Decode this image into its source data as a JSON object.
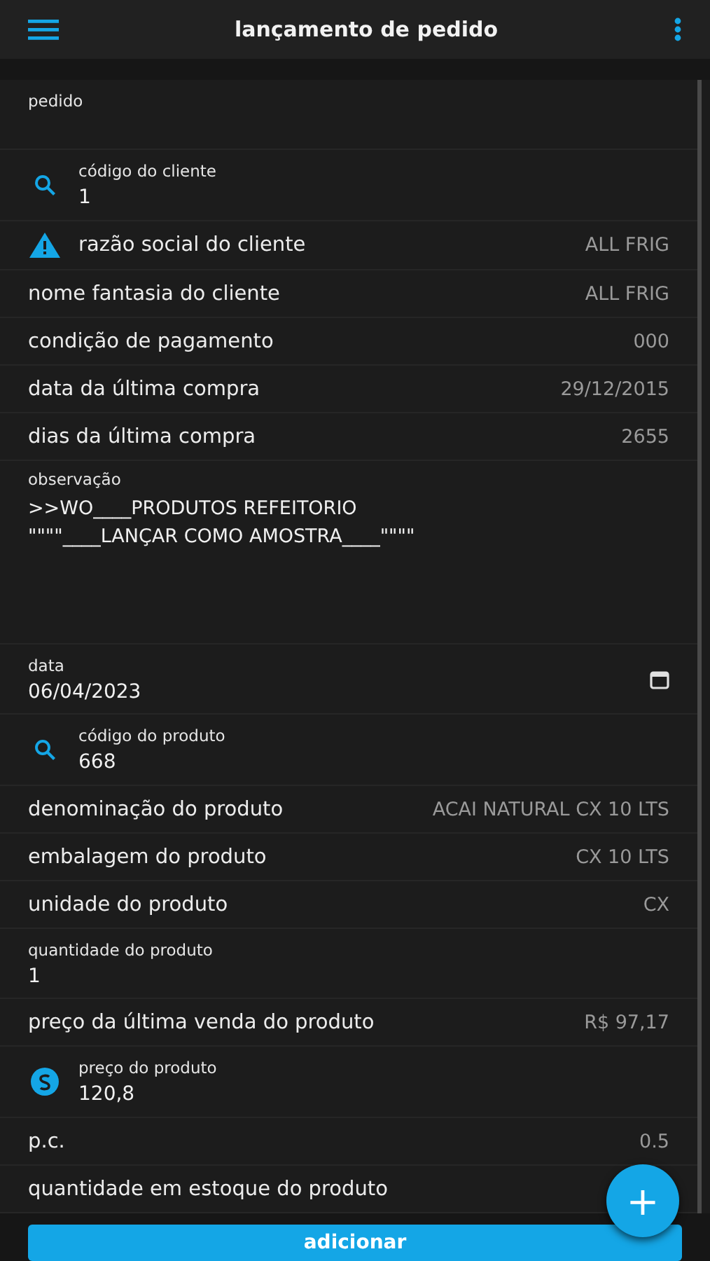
{
  "app_bar": {
    "title": "lançamento de pedido"
  },
  "rows": [
    {
      "kind": "section",
      "label": "pedido"
    },
    {
      "kind": "lookup",
      "label": "código do cliente",
      "value": "1"
    },
    {
      "kind": "alert",
      "label": "razão social do cliente",
      "value": "ALL FRIG"
    },
    {
      "kind": "pair",
      "label": "nome fantasia do cliente",
      "value": "ALL FRIG"
    },
    {
      "kind": "pair",
      "label": "condição de pagamento",
      "value": "000"
    },
    {
      "kind": "pair",
      "label": "data da última compra",
      "value": "29/12/2015"
    },
    {
      "kind": "pair",
      "label": "dias da última compra",
      "value": "2655"
    },
    {
      "kind": "note",
      "label": "observação",
      "lines": [
        ">>WO____PRODUTOS REFEITORIO",
        "\"\"\"\"____LANÇAR COMO AMOSTRA____\"\"\"\""
      ]
    },
    {
      "kind": "date",
      "label": "data",
      "value": "06/04/2023"
    },
    {
      "kind": "lookup",
      "label": "código do produto",
      "value": "668"
    },
    {
      "kind": "pair",
      "label": "denominação do produto",
      "value": "ACAI NATURAL CX 10 LTS"
    },
    {
      "kind": "pair",
      "label": "embalagem do produto",
      "value": "CX 10 LTS"
    },
    {
      "kind": "pair",
      "label": "unidade do produto",
      "value": "CX"
    },
    {
      "kind": "field",
      "label": "quantidade do produto",
      "value": "1"
    },
    {
      "kind": "pair",
      "label": "preço da última venda do produto",
      "value": "R$ 97,17"
    },
    {
      "kind": "price",
      "label": "preço do produto",
      "value": "120,8"
    },
    {
      "kind": "pair",
      "label": "p.c.",
      "value": "0.5"
    },
    {
      "kind": "pair",
      "label": "quantidade em estoque do produto"
    }
  ],
  "fab": {
    "label": "+"
  },
  "footer": {
    "button": "adicionar"
  }
}
